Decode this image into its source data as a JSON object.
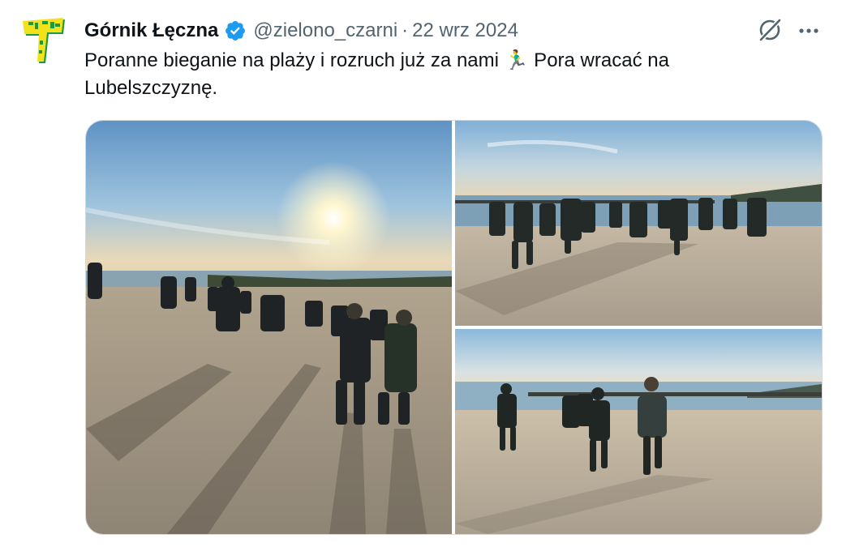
{
  "tweet": {
    "author_name": "Górnik Łęczna",
    "handle": "@zielono_czarni",
    "separator": "·",
    "date": "22 wrz 2024",
    "text": "Poranne bieganie na plaży i rozruch już za nami 🏃‍♂️ Pora wracać na Lubelszczyznę.",
    "verified": true,
    "avatar_icon": "club-crest-icon",
    "action_icons": [
      "grok-icon",
      "more-icon"
    ]
  },
  "media": {
    "count": 3,
    "photos": [
      {
        "name": "photo-beach-run-sunrise"
      },
      {
        "name": "photo-beach-run-group"
      },
      {
        "name": "photo-beach-run-sprint"
      }
    ]
  },
  "colors": {
    "text_primary": "#0f1419",
    "text_secondary": "#536471",
    "verified_blue": "#1d9bf0",
    "border": "#cfd9de",
    "crest_yellow": "#f2e21b",
    "crest_green": "#1e9a3c"
  }
}
